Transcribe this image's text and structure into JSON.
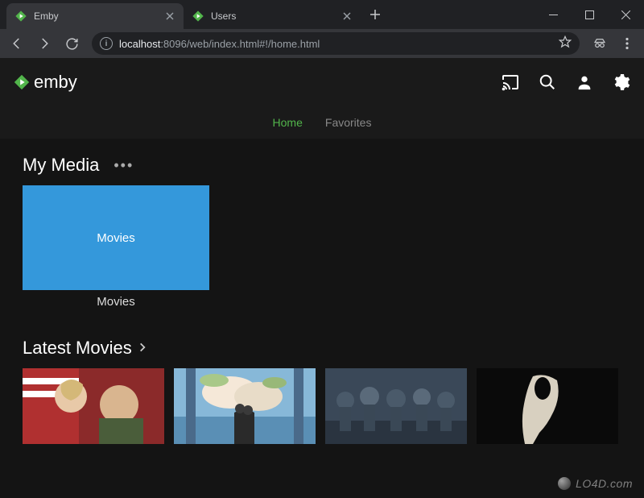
{
  "window": {
    "tabs": [
      {
        "title": "Emby"
      },
      {
        "title": "Users"
      }
    ]
  },
  "addressbar": {
    "host": "localhost",
    "rest": ":8096/web/index.html#!/home.html"
  },
  "app": {
    "brand": "emby",
    "nav": {
      "home": "Home",
      "favorites": "Favorites"
    },
    "sections": {
      "my_media": {
        "title": "My Media",
        "card_label": "Movies",
        "caption": "Movies"
      },
      "latest": {
        "title": "Latest Movies"
      }
    }
  },
  "watermark": "LO4D.com",
  "colors": {
    "accent": "#52b54b",
    "card": "#3498db"
  }
}
